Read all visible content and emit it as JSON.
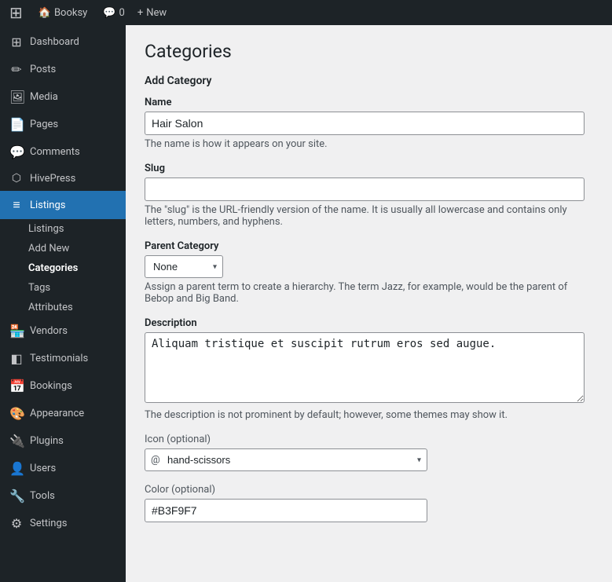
{
  "topbar": {
    "wp_icon": "⊞",
    "site_name": "Booksy",
    "comments_label": "0",
    "new_label": "New"
  },
  "sidebar": {
    "items": [
      {
        "id": "dashboard",
        "label": "Dashboard",
        "icon": "⊞"
      },
      {
        "id": "posts",
        "label": "Posts",
        "icon": "📝"
      },
      {
        "id": "media",
        "label": "Media",
        "icon": "🖼"
      },
      {
        "id": "pages",
        "label": "Pages",
        "icon": "📄"
      },
      {
        "id": "comments",
        "label": "Comments",
        "icon": "💬"
      },
      {
        "id": "hivepress",
        "label": "HivePress",
        "icon": "⬡"
      },
      {
        "id": "listings",
        "label": "Listings",
        "icon": "≡",
        "active": true
      },
      {
        "id": "vendors",
        "label": "Vendors",
        "icon": "🏪"
      },
      {
        "id": "testimonials",
        "label": "Testimonials",
        "icon": "◧"
      },
      {
        "id": "bookings",
        "label": "Bookings",
        "icon": "📅"
      },
      {
        "id": "appearance",
        "label": "Appearance",
        "icon": "🎨"
      },
      {
        "id": "plugins",
        "label": "Plugins",
        "icon": "🔌"
      },
      {
        "id": "users",
        "label": "Users",
        "icon": "👤"
      },
      {
        "id": "tools",
        "label": "Tools",
        "icon": "🔧"
      },
      {
        "id": "settings",
        "label": "Settings",
        "icon": "⚙"
      }
    ],
    "submenu": {
      "listings_sub": [
        {
          "id": "listings-list",
          "label": "Listings"
        },
        {
          "id": "add-new",
          "label": "Add New"
        },
        {
          "id": "categories",
          "label": "Categories",
          "active": true
        },
        {
          "id": "tags",
          "label": "Tags"
        },
        {
          "id": "attributes",
          "label": "Attributes"
        }
      ]
    }
  },
  "content": {
    "page_title": "Categories",
    "add_category_title": "Add Category",
    "fields": {
      "name_label": "Name",
      "name_value": "Hair Salon",
      "name_placeholder": "",
      "name_hint": "The name is how it appears on your site.",
      "slug_label": "Slug",
      "slug_value": "",
      "slug_placeholder": "",
      "slug_hint": "The \"slug\" is the URL-friendly version of the name. It is usually all lowercase and contains only letters, numbers, and hyphens.",
      "parent_label": "Parent Category",
      "parent_value": "None",
      "parent_hint": "Assign a parent term to create a hierarchy. The term Jazz, for example, would be the parent of Bebop and Big Band.",
      "description_label": "Description",
      "description_value": "Aliquam tristique et suscipit rutrum eros sed augue.",
      "description_hint": "The description is not prominent by default; however, some themes may show it.",
      "icon_label": "Icon (optional)",
      "icon_value": "hand-scissors",
      "icon_prefix": "@",
      "color_label": "Color (optional)",
      "color_value": "#B3F9F7"
    }
  }
}
